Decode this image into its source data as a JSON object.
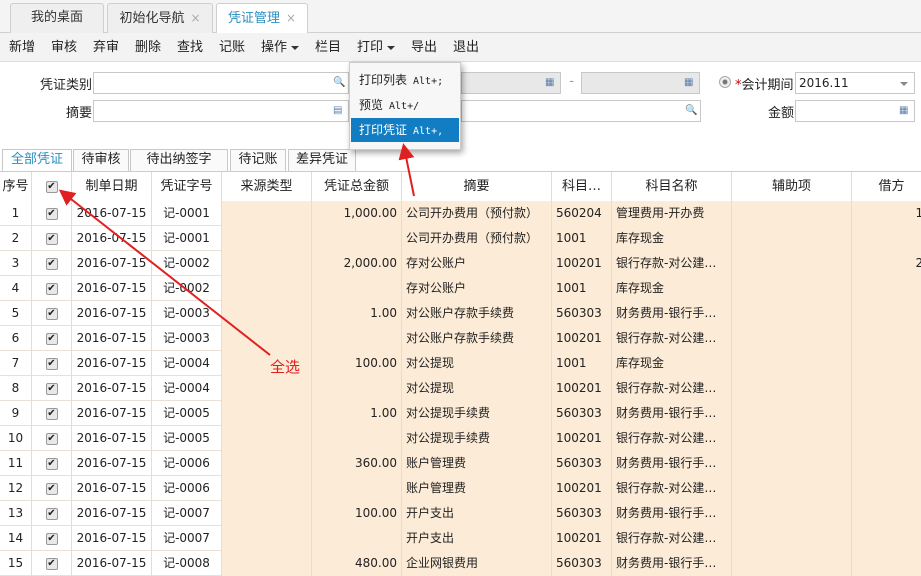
{
  "tabs": [
    {
      "label": "我的桌面",
      "closable": false
    },
    {
      "label": "初始化导航",
      "closable": true
    },
    {
      "label": "凭证管理",
      "closable": true,
      "active": true
    }
  ],
  "close_glyph": "×",
  "toolbar": [
    "新增",
    "审核",
    "弃审",
    "删除",
    "查找",
    "记账",
    "操作",
    "栏目",
    "打印",
    "导出",
    "退出"
  ],
  "print_menu": [
    {
      "label": "打印列表",
      "shortcut": "Alt+;"
    },
    {
      "label": "预览",
      "shortcut": "Alt+/"
    },
    {
      "label": "打印凭证",
      "shortcut": "Alt+,",
      "selected": true
    }
  ],
  "filters": {
    "voucher_type_label": "凭证类别",
    "summary_label": "摘要",
    "period_required": "*",
    "period_label": "会计期间",
    "period_value": "2016.11",
    "amount_label": "金额",
    "range_sep": "-"
  },
  "sub_tabs": [
    "全部凭证",
    "待审核",
    "待出纳签字",
    "待记账",
    "差异凭证"
  ],
  "columns": [
    "序号",
    "",
    "制单日期",
    "凭证字号",
    "来源类型",
    "凭证总金额",
    "摘要",
    "科目…",
    "科目名称",
    "辅助项",
    "借方"
  ],
  "rows": [
    {
      "no": "1",
      "date": "2016-07-15",
      "voucher": "记-0001",
      "total": "1,000.00",
      "summary": "公司开办费用（预付款）",
      "code": "560204",
      "name": "管理费用-开办费",
      "debit": "1,"
    },
    {
      "no": "2",
      "date": "2016-07-15",
      "voucher": "记-0001",
      "total": "",
      "summary": "公司开办费用（预付款）",
      "code": "1001",
      "name": "库存现金",
      "debit": ""
    },
    {
      "no": "3",
      "date": "2016-07-15",
      "voucher": "记-0002",
      "total": "2,000.00",
      "summary": "存对公账户",
      "code": "100201",
      "name": "银行存款-对公建…",
      "debit": "2,"
    },
    {
      "no": "4",
      "date": "2016-07-15",
      "voucher": "记-0002",
      "total": "",
      "summary": "存对公账户",
      "code": "1001",
      "name": "库存现金",
      "debit": ""
    },
    {
      "no": "5",
      "date": "2016-07-15",
      "voucher": "记-0003",
      "total": "1.00",
      "summary": "对公账户存款手续费",
      "code": "560303",
      "name": "财务费用-银行手…",
      "debit": ""
    },
    {
      "no": "6",
      "date": "2016-07-15",
      "voucher": "记-0003",
      "total": "",
      "summary": "对公账户存款手续费",
      "code": "100201",
      "name": "银行存款-对公建…",
      "debit": ""
    },
    {
      "no": "7",
      "date": "2016-07-15",
      "voucher": "记-0004",
      "total": "100.00",
      "summary": "对公提现",
      "code": "1001",
      "name": "库存现金",
      "debit": ""
    },
    {
      "no": "8",
      "date": "2016-07-15",
      "voucher": "记-0004",
      "total": "",
      "summary": "对公提现",
      "code": "100201",
      "name": "银行存款-对公建…",
      "debit": ""
    },
    {
      "no": "9",
      "date": "2016-07-15",
      "voucher": "记-0005",
      "total": "1.00",
      "summary": "对公提现手续费",
      "code": "560303",
      "name": "财务费用-银行手…",
      "debit": ""
    },
    {
      "no": "10",
      "date": "2016-07-15",
      "voucher": "记-0005",
      "total": "",
      "summary": "对公提现手续费",
      "code": "100201",
      "name": "银行存款-对公建…",
      "debit": ""
    },
    {
      "no": "11",
      "date": "2016-07-15",
      "voucher": "记-0006",
      "total": "360.00",
      "summary": "账户管理费",
      "code": "560303",
      "name": "财务费用-银行手…",
      "debit": ""
    },
    {
      "no": "12",
      "date": "2016-07-15",
      "voucher": "记-0006",
      "total": "",
      "summary": "账户管理费",
      "code": "100201",
      "name": "银行存款-对公建…",
      "debit": ""
    },
    {
      "no": "13",
      "date": "2016-07-15",
      "voucher": "记-0007",
      "total": "100.00",
      "summary": "开户支出",
      "code": "560303",
      "name": "财务费用-银行手…",
      "debit": ""
    },
    {
      "no": "14",
      "date": "2016-07-15",
      "voucher": "记-0007",
      "total": "",
      "summary": "开户支出",
      "code": "100201",
      "name": "银行存款-对公建…",
      "debit": ""
    },
    {
      "no": "15",
      "date": "2016-07-15",
      "voucher": "记-0008",
      "total": "480.00",
      "summary": "企业网银费用",
      "code": "560303",
      "name": "财务费用-银行手…",
      "debit": ""
    }
  ],
  "annotation": {
    "label": "全选",
    "color": "#e02020"
  }
}
